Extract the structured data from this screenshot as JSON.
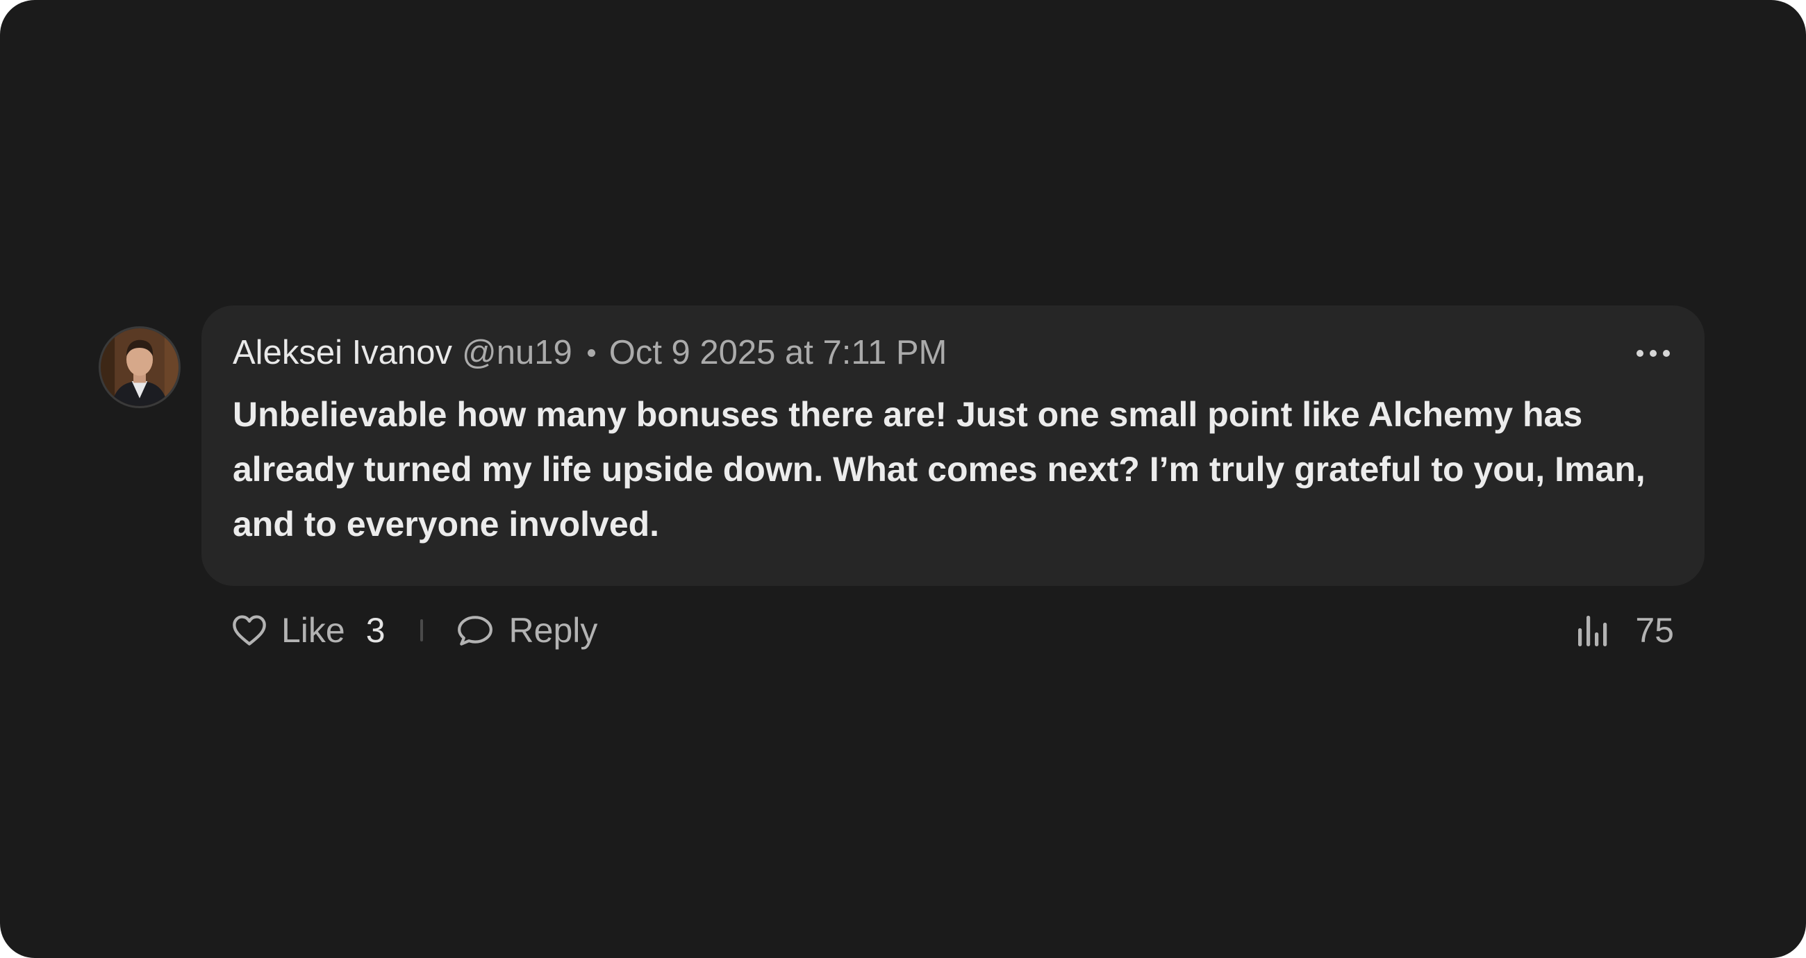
{
  "comment": {
    "author_name": "Aleksei Ivanov",
    "author_handle": "@nu19",
    "timestamp": "Oct 9 2025 at 7:11 PM",
    "text": "Unbelievable how many bonuses there are! Just one small point like Alchemy has already turned my life upside down. What comes next? I’m truly grateful to you, Iman, and to everyone involved.",
    "more_icon": "more-horizontal-icon"
  },
  "actions": {
    "like_label": "Like",
    "like_count": "3",
    "like_icon": "heart-icon",
    "reply_label": "Reply",
    "reply_icon": "chat-bubble-icon",
    "views_count": "75",
    "views_icon": "bar-chart-icon"
  },
  "colors": {
    "background": "#1b1b1b",
    "bubble": "#262626",
    "primary_text": "#ececec",
    "secondary_text": "#ababab"
  }
}
